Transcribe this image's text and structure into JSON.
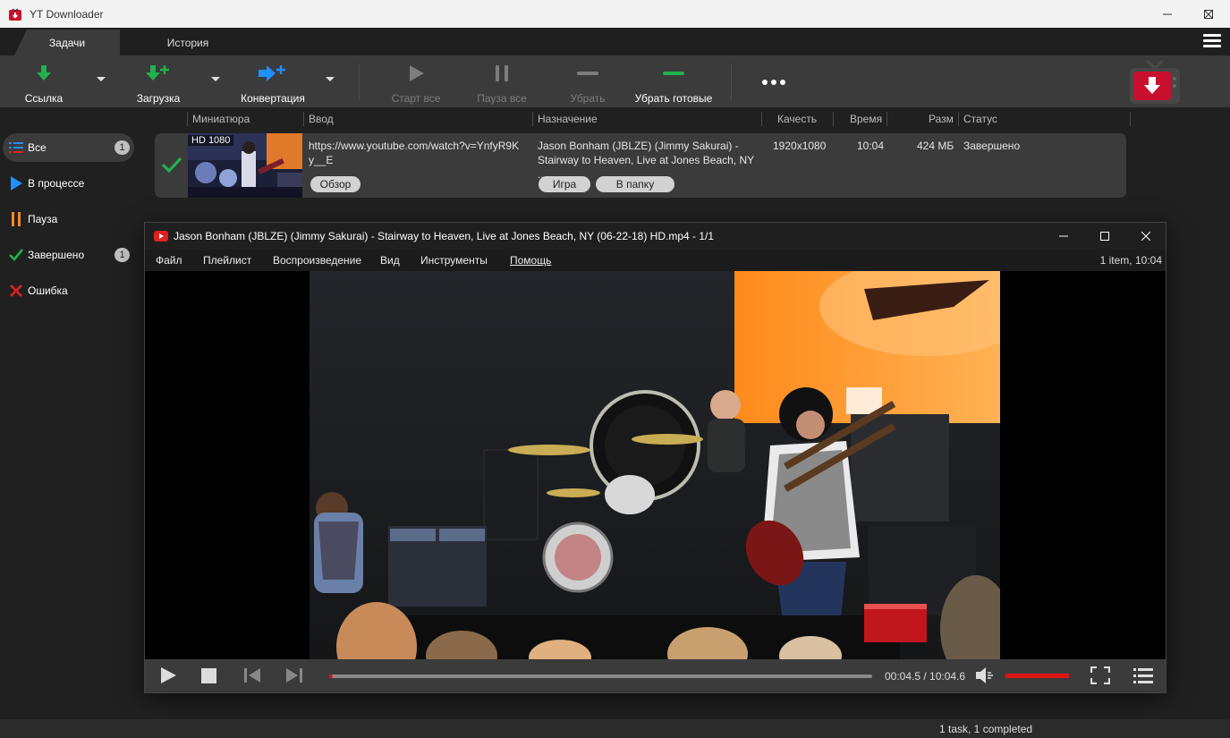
{
  "window": {
    "title": "YT Downloader",
    "minimize": "—",
    "maximize": "☐",
    "close": "✕"
  },
  "tabs": [
    {
      "label": "Задачи",
      "active": true
    },
    {
      "label": "История",
      "active": false
    }
  ],
  "menu_icon": "hamburger-icon",
  "toolbar": {
    "link_label": "Ссылка",
    "download_label": "Загрузка",
    "convert_label": "Конвертация",
    "start_all_label": "Старт все",
    "pause_all_label": "Пауза все",
    "remove_label": "Убрать",
    "remove_done_label": "Убрать готовые",
    "more_icon": "more-dots-icon",
    "logo_icon": "tv-download-logo"
  },
  "columns": {
    "thumbnail": "Миниатюра",
    "input": "Ввод",
    "destination": "Назначение",
    "quality": "Качесть",
    "time": "Время",
    "size": "Разм",
    "status": "Статус"
  },
  "sidebar": {
    "items": [
      {
        "label": "Все",
        "icon": "list-icon",
        "count": "1",
        "active": true
      },
      {
        "label": "В процессе",
        "icon": "play-icon",
        "count": "",
        "active": false
      },
      {
        "label": "Пауза",
        "icon": "pause-icon",
        "count": "",
        "active": false
      },
      {
        "label": "Завершено",
        "icon": "check-icon",
        "count": "1",
        "active": false
      },
      {
        "label": "Ошибка",
        "icon": "error-x-icon",
        "count": "",
        "active": false
      }
    ]
  },
  "task": {
    "thumb_badge": "HD 1080",
    "url_line1": "https://www.youtube.com/watch?v=YnfyR9K",
    "url_line2": "y__E",
    "browse_label": "Обзор",
    "dest_line1": "Jason Bonham (JBLZE) (Jimmy Sakurai) -",
    "dest_line2": "Stairway to Heaven, Live at Jones Beach, NY ...",
    "play_label": "Игра",
    "folder_label": "В папку",
    "quality": "1920x1080",
    "time": "10:04",
    "size": "424 МБ",
    "status": "Завершено"
  },
  "player": {
    "title": "Jason Bonham (JBLZE) (Jimmy Sakurai) - Stairway to Heaven, Live at Jones Beach, NY (06-22-18) HD.mp4 - 1/1",
    "menu": [
      "Файл",
      "Плейлист",
      "Воспроизведение",
      "Вид",
      "Инструменты",
      "Помощь"
    ],
    "info": "1 item, 10:04",
    "time_display": "00:04.5 / 10:04.6",
    "progress_fraction": 0.007,
    "volume_fraction": 1.0
  },
  "statusbar": {
    "text": "1 task, 1 completed"
  },
  "colors": {
    "accent_green": "#22b14c",
    "accent_blue": "#1e90ff",
    "accent_orange": "#f08a24",
    "error_red": "#e02020",
    "progress_red": "#e01515",
    "panel": "#3b3b3b",
    "background": "#202020"
  }
}
